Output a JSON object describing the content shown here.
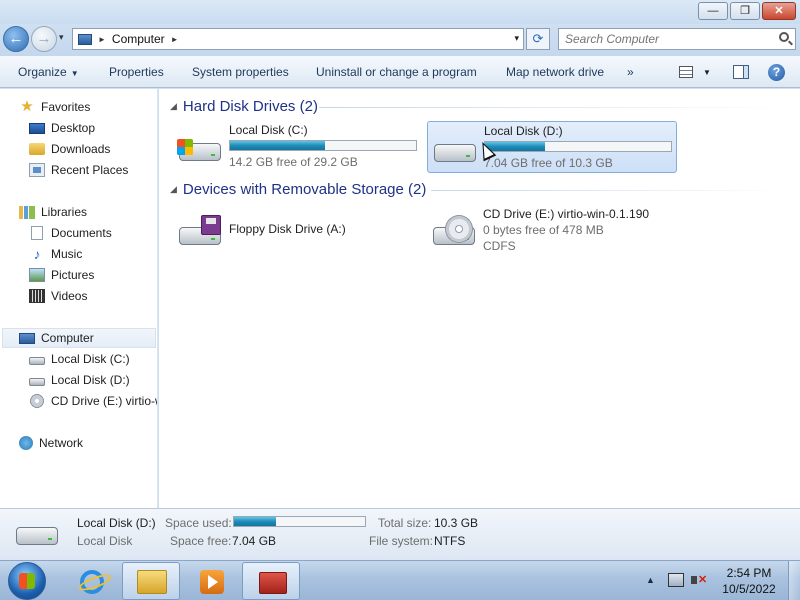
{
  "window": {
    "minimize_glyph": "—",
    "maximize_glyph": "❐",
    "close_glyph": "✕"
  },
  "address": {
    "back_glyph": "←",
    "forward_glyph": "→",
    "separator": "►",
    "location": "Computer",
    "trailing_separator": "►",
    "dropdown_glyph": "▾",
    "refresh_glyph": "⟳"
  },
  "search": {
    "placeholder": "Search Computer"
  },
  "toolbar": {
    "organize": "Organize",
    "properties": "Properties",
    "system_properties": "System properties",
    "uninstall": "Uninstall or change a program",
    "map_network_drive": "Map network drive",
    "more": "»",
    "help_glyph": "?"
  },
  "nav": {
    "favorites": "Favorites",
    "desktop": "Desktop",
    "downloads": "Downloads",
    "recent_places": "Recent Places",
    "libraries": "Libraries",
    "documents": "Documents",
    "music": "Music",
    "pictures": "Pictures",
    "videos": "Videos",
    "computer": "Computer",
    "local_c": "Local Disk (C:)",
    "local_d": "Local Disk (D:)",
    "cd_drive": "CD Drive (E:) virtio-w",
    "network": "Network"
  },
  "groups": {
    "hard_disks": "Hard Disk Drives (2)",
    "removable": "Devices with Removable Storage (2)"
  },
  "drives": {
    "c": {
      "name": "Local Disk (C:)",
      "free": "14.2 GB free of 29.2 GB",
      "used_fraction": 0.51
    },
    "d": {
      "name": "Local Disk (D:)",
      "free": "7.04 GB free of 10.3 GB",
      "used_fraction": 0.32
    },
    "floppy": {
      "name": "Floppy Disk Drive (A:)"
    },
    "cd": {
      "name": "CD Drive (E:) virtio-win-0.1.190",
      "free": "0 bytes free of 478 MB",
      "fs": "CDFS"
    }
  },
  "details": {
    "name": "Local Disk (D:)",
    "type": "Local Disk",
    "space_used_label": "Space used:",
    "space_used_fraction": 0.32,
    "space_free_label": "Space free:",
    "space_free_value": "7.04 GB",
    "total_size_label": "Total size:",
    "total_size_value": "10.3 GB",
    "file_system_label": "File system:",
    "file_system_value": "NTFS"
  },
  "taskbar": {
    "tray_arrow": "▲",
    "time": "2:54 PM",
    "date": "10/5/2022"
  },
  "colors": {
    "selection": "#cde0f7",
    "progress": "#1f8bb8",
    "group_header": "#1e3287"
  }
}
